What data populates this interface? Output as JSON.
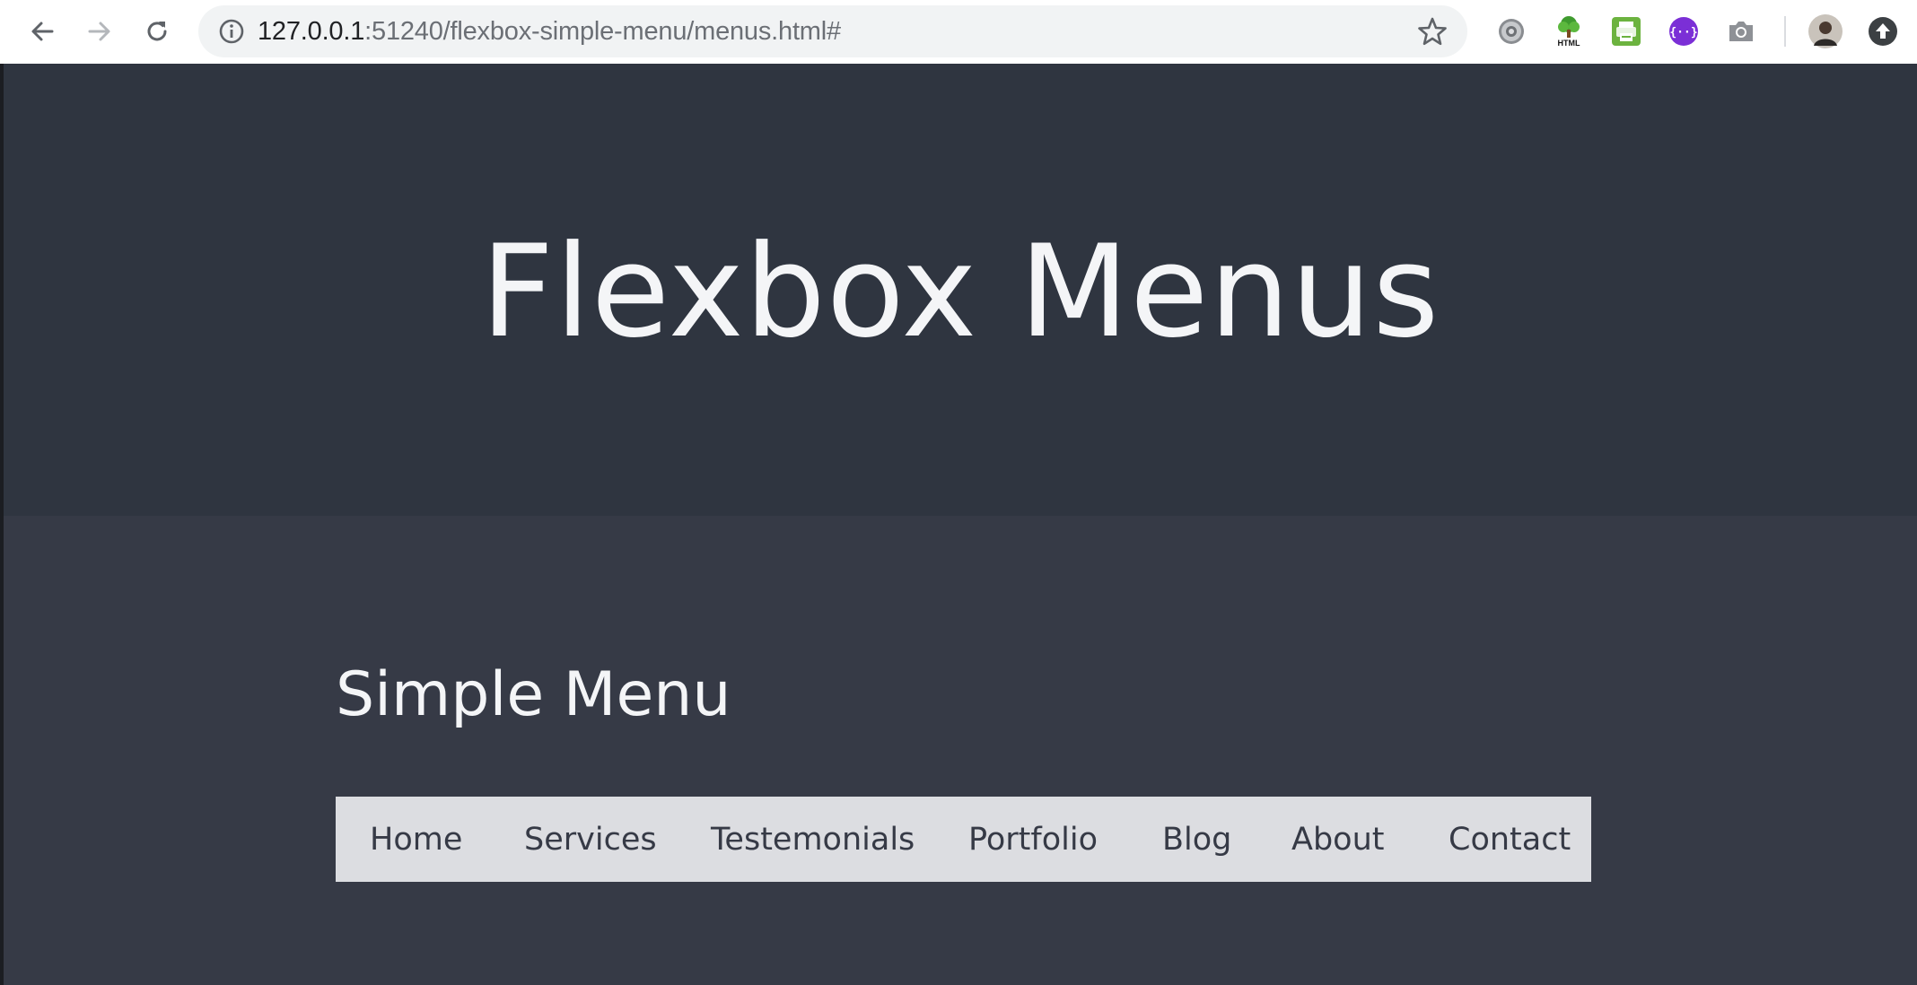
{
  "browser": {
    "url_host": "127.0.0.1",
    "url_rest": ":51240/flexbox-simple-menu/menus.html#",
    "extensions": [
      "settings-gear-icon",
      "html-tree-icon",
      "print-icon",
      "bracket-extension-icon",
      "camera-icon"
    ]
  },
  "hero": {
    "title": "Flexbox Menus"
  },
  "section": {
    "title": "Simple Menu",
    "menu_items": [
      "Home",
      "Services",
      "Testemonials",
      "Portfolio",
      "Blog",
      "About",
      "Contact"
    ]
  },
  "colors": {
    "hero_bg": "#2f3540",
    "section_bg": "#363a46",
    "menu_bg": "#dcdde1",
    "menu_text": "#363a46",
    "heading_text": "#f4f5f7"
  }
}
